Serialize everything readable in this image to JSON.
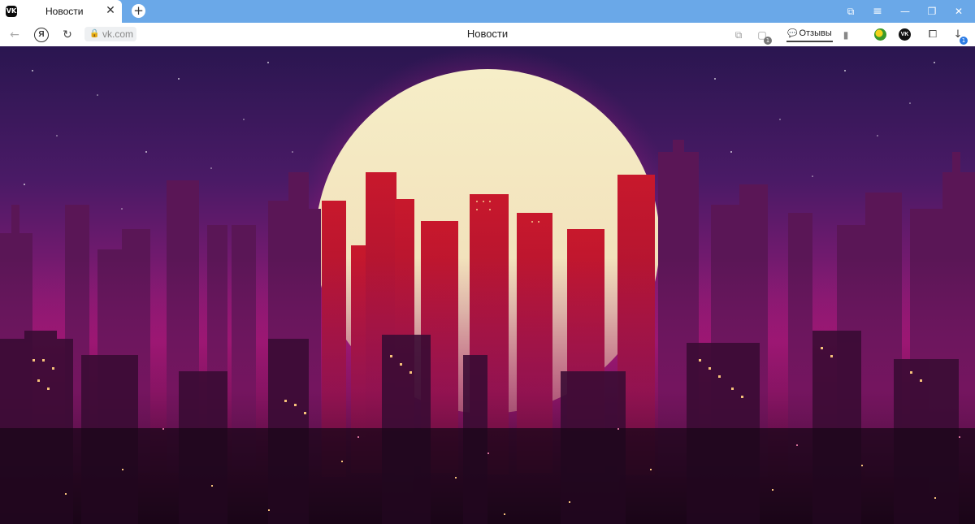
{
  "tab": {
    "title": "Новости",
    "favicon_text": "VK",
    "close_glyph": "✕",
    "icon": "vk-favicon"
  },
  "new_tab_glyph": "+",
  "window_controls": {
    "tabs_glyph": "⧉",
    "menu_glyph": "≡",
    "minimize_glyph": "—",
    "restore_glyph": "❐",
    "close_glyph": "✕"
  },
  "toolbar": {
    "back_glyph": "←",
    "yandex_glyph": "Я",
    "reload_glyph": "↻",
    "lock_glyph": "🔒",
    "url": "vk.com",
    "page_title": "Новости",
    "feedback_label": "Отзывы",
    "feedback_glyph": "💬",
    "bookmark_glyph": "🔖",
    "download_glyph": "↓",
    "download_badge": "1",
    "tabs_badge": "1"
  },
  "colors": {
    "tabbar": "#6aa8e8",
    "sky_top": "#2a1650",
    "sky_mid": "#6a1a6a",
    "horizon": "#b3187a",
    "sun": "#f3e9c0"
  },
  "content": {
    "description_icon": "synthwave-city-wallpaper"
  }
}
